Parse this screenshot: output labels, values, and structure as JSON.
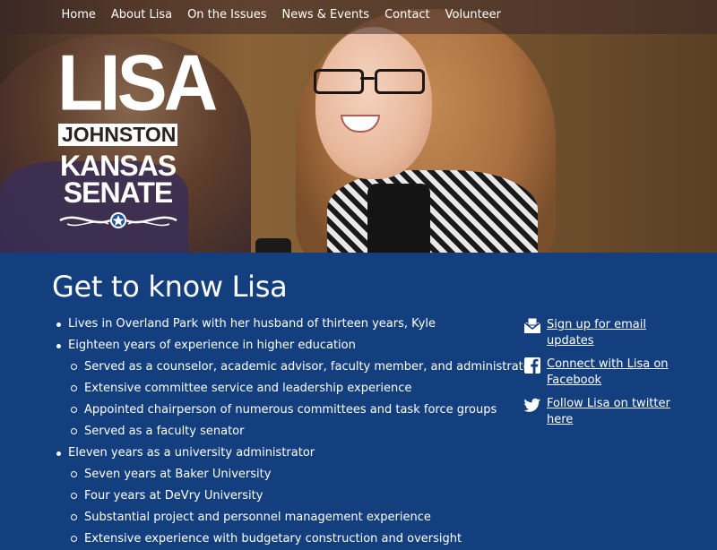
{
  "nav": {
    "items": [
      {
        "label": "Home"
      },
      {
        "label": "About Lisa"
      },
      {
        "label": "On the Issues"
      },
      {
        "label": "News & Events"
      },
      {
        "label": "Contact"
      },
      {
        "label": "Volunteer"
      }
    ]
  },
  "logo": {
    "first_name": "LISA",
    "last_name": "JOHNSTON",
    "line1": "KANSAS",
    "line2": "SENATE"
  },
  "main": {
    "heading": "Get to know Lisa",
    "bio": [
      {
        "level": 1,
        "text": "Lives in Overland Park with her husband of thirteen years, Kyle"
      },
      {
        "level": 1,
        "text": "Eighteen years of experience in higher education"
      },
      {
        "level": 2,
        "text": "Served as a counselor, academic advisor, faculty member, and administrator"
      },
      {
        "level": 2,
        "text": "Extensive committee service and leadership experience"
      },
      {
        "level": 2,
        "text": "Appointed chairperson of numerous committees and task force groups"
      },
      {
        "level": 2,
        "text": "Served as a faculty senator"
      },
      {
        "level": 1,
        "text": "Eleven years as a university administrator"
      },
      {
        "level": 2,
        "text": "Seven years at Baker University"
      },
      {
        "level": 2,
        "text": "Four years at DeVry University"
      },
      {
        "level": 2,
        "text": "Substantial project and personnel management experience"
      },
      {
        "level": 2,
        "text": "Extensive experience with budgetary construction and oversight"
      }
    ]
  },
  "sidebar": {
    "links": [
      {
        "icon": "email-icon",
        "line1": "Sign up for email",
        "line2": "updates"
      },
      {
        "icon": "facebook-icon",
        "line1": "Connect with Lisa on",
        "line2": "Facebook"
      },
      {
        "icon": "twitter-icon",
        "line1": "Follow Lisa on twitter",
        "line2": "here"
      }
    ]
  },
  "colors": {
    "content_background": "#143f7f",
    "text": "#ffffff"
  }
}
